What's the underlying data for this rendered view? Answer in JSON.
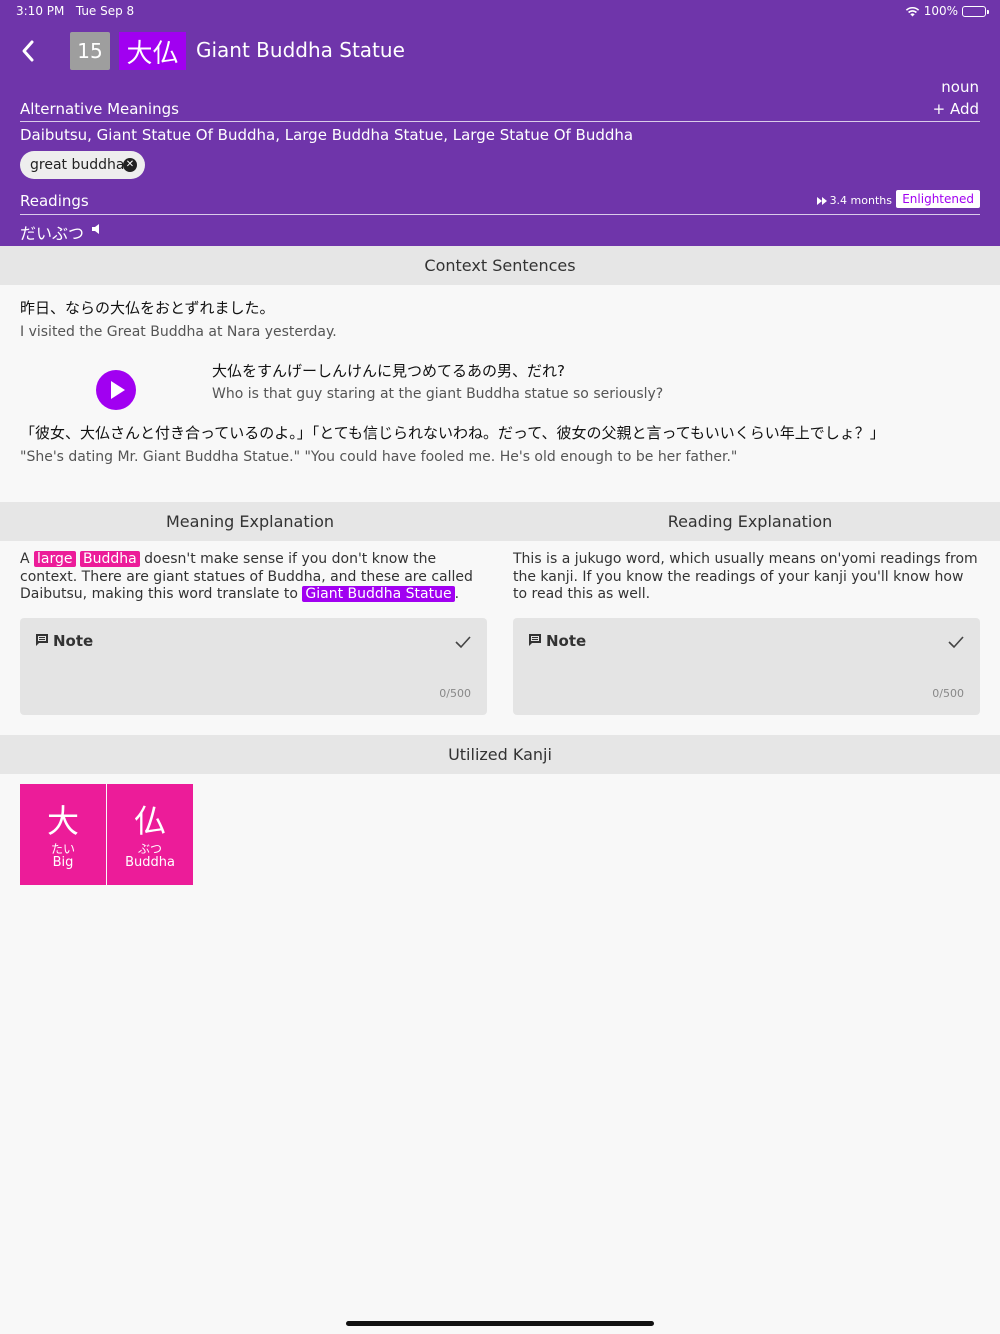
{
  "status_bar": {
    "time": "3:10 PM",
    "date": "Tue Sep 8",
    "battery": "100%"
  },
  "header": {
    "level": "15",
    "characters": "大仏",
    "title": "Giant Buddha Statue",
    "part_of_speech": "noun",
    "alt_meanings_label": "Alternative Meanings",
    "add_label": "+ Add",
    "alt_meanings": "Daibutsu, Giant Statue Of Buddha, Large Buddha Statue, Large Statue Of Buddha",
    "user_synonym": "great buddha",
    "readings_label": "Readings",
    "srs_time": "3.4 months",
    "srs_stage": "Enlightened",
    "reading": "だいぶつ"
  },
  "context": {
    "title": "Context Sentences",
    "sentences": [
      {
        "jp": "昨日、ならの大仏をおとずれました。",
        "en": "I visited the Great Buddha at Nara yesterday."
      },
      {
        "jp": "大仏をすんげーしんけんに見つめてるあの男、だれ?",
        "en": "Who is that guy staring at the giant Buddha statue so seriously?"
      },
      {
        "jp": "「彼女、大仏さんと付き合っているのよ。」「とても信じられないわね。だって、彼女の父親と言ってもいいくらい年上でしょ？」",
        "en": "\"She's dating Mr. Giant Buddha Statue.\" \"You could have fooled me. He's old enough to be her father.\""
      }
    ]
  },
  "meaning": {
    "title": "Meaning Explanation",
    "parts": [
      "A",
      "large",
      "Buddha",
      "doesn't make sense if you don't know the context. There are giant statues of Buddha, and these are called Daibutsu, making this word translate to",
      "Giant Buddha Statue",
      "."
    ],
    "note_label": "Note",
    "note_count": "0/500"
  },
  "reading_expl": {
    "title": "Reading Explanation",
    "text": "This is a jukugo word, which usually means on'yomi readings from the kanji. If you know the readings of your kanji you'll know how to read this as well.",
    "note_label": "Note",
    "note_count": "0/500"
  },
  "kanji": {
    "title": "Utilized Kanji",
    "items": [
      {
        "char": "大",
        "reading": "たい",
        "meaning": "Big"
      },
      {
        "char": "仏",
        "reading": "ぶつ",
        "meaning": "Buddha"
      }
    ]
  },
  "colors": {
    "header_bg": "#6f35aa",
    "vocab": "#a100f1",
    "radical_kanji": "#ec1c99",
    "level_badge": "#9e9e9e"
  }
}
